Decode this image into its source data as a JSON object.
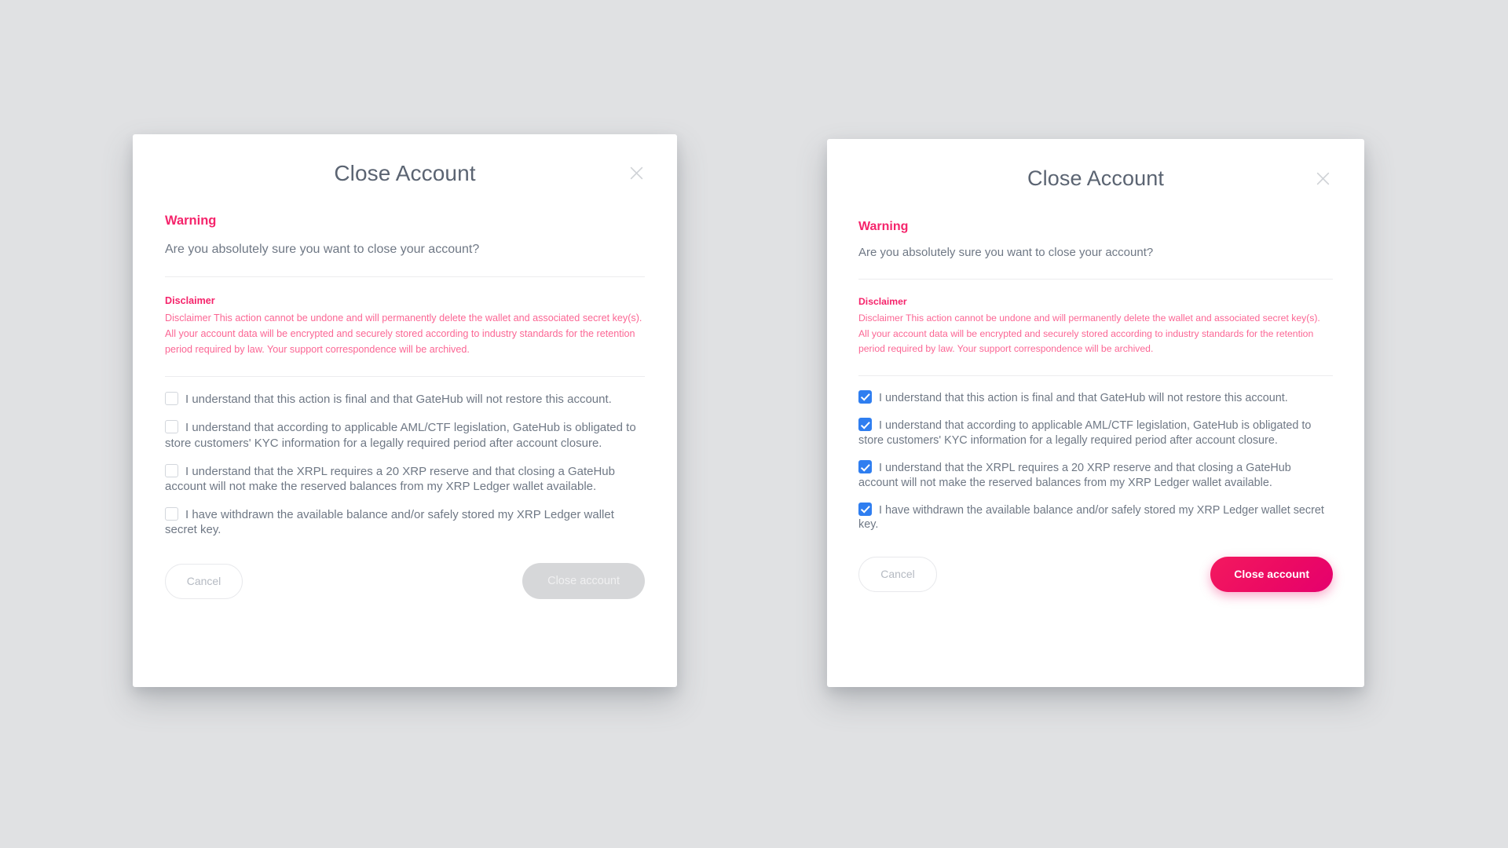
{
  "background_color": "#e0e1e3",
  "accent_pink": "#ed0a66",
  "warning_pink": "#f5246b",
  "disclaimer_pink": "#fb6694",
  "checkbox_blue": "#2f7ef0",
  "dialogs": [
    {
      "id": "close-account-unchecked",
      "title": "Close Account",
      "close_icon": "close-icon",
      "warning": {
        "heading": "Warning",
        "text": "Are you absolutely sure you want to close your account?"
      },
      "disclaimer": {
        "heading": "Disclaimer",
        "body": "Disclaimer This action cannot be undone and will permanently delete the wallet and associated secret key(s). All your account data will be encrypted and securely stored according to industry standards for the retention period required by law. Your support correspondence will be archived."
      },
      "checkboxes": [
        {
          "label": "I understand that this action is final and that GateHub will not restore this account.",
          "checked": false
        },
        {
          "label": "I understand that according to applicable AML/CTF legislation, GateHub is obligated to store customers' KYC information for a legally required period after account closure.",
          "checked": false
        },
        {
          "label": "I understand that the XRPL requires a 20 XRP reserve and that closing a GateHub account will not make the reserved balances from my XRP Ledger wallet available.",
          "checked": false
        },
        {
          "label": "I have withdrawn the available balance and/or safely stored my XRP Ledger wallet secret key.",
          "checked": false
        }
      ],
      "cancel_label": "Cancel",
      "submit_label": "Close account",
      "submit_enabled": false
    },
    {
      "id": "close-account-checked",
      "title": "Close Account",
      "close_icon": "close-icon",
      "warning": {
        "heading": "Warning",
        "text": "Are you absolutely sure you want to close your account?"
      },
      "disclaimer": {
        "heading": "Disclaimer",
        "body": "Disclaimer This action cannot be undone and will permanently delete the wallet and associated secret key(s). All your account data will be encrypted and securely stored according to industry standards for the retention period required by law. Your support correspondence will be archived."
      },
      "checkboxes": [
        {
          "label": "I understand that this action is final and that GateHub will not restore this account.",
          "checked": true
        },
        {
          "label": "I understand that according to applicable AML/CTF legislation, GateHub is obligated to store customers' KYC information for a legally required period after account closure.",
          "checked": true
        },
        {
          "label": "I understand that the XRPL requires a 20 XRP reserve and that closing a GateHub account will not make the reserved balances from my XRP Ledger wallet available.",
          "checked": true
        },
        {
          "label": "I have withdrawn the available balance and/or safely stored my XRP Ledger wallet secret key.",
          "checked": true
        }
      ],
      "cancel_label": "Cancel",
      "submit_label": "Close account",
      "submit_enabled": true
    }
  ]
}
